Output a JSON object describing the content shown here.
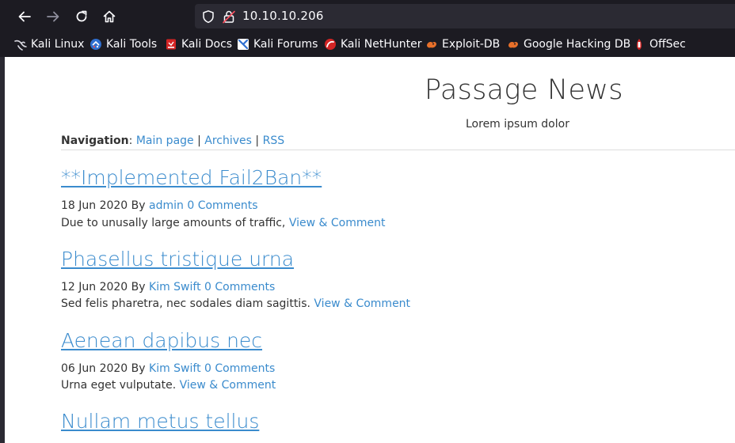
{
  "browser": {
    "url": "10.10.10.206",
    "bookmarks": [
      {
        "label": "Kali Linux",
        "icon": "kali-dragon-icon",
        "color": "#111111"
      },
      {
        "label": "Kali Tools",
        "icon": "kali-tools-icon",
        "color": "#2f6fd0"
      },
      {
        "label": "Kali Docs",
        "icon": "kali-docs-icon",
        "color": "#d42424"
      },
      {
        "label": "Kali Forums",
        "icon": "kali-forums-icon",
        "color": "#2f6fd0"
      },
      {
        "label": "Kali NetHunter",
        "icon": "nethunter-icon",
        "color": "#d42424"
      },
      {
        "label": "Exploit-DB",
        "icon": "exploit-db-icon",
        "color": "#e8702a"
      },
      {
        "label": "Google Hacking DB",
        "icon": "ghdb-icon",
        "color": "#e8702a"
      },
      {
        "label": "OffSec",
        "icon": "offsec-icon",
        "color": "#d42424"
      }
    ]
  },
  "site": {
    "title": "Passage News",
    "subtitle": "Lorem ipsum dolor"
  },
  "nav": {
    "label": "Navigation",
    "separator_colon": ":",
    "links": [
      "Main page",
      "Archives",
      "RSS"
    ],
    "separator": "|"
  },
  "posts": [
    {
      "title": "**Implemented Fail2Ban**",
      "date_by": "18 Jun 2020 By",
      "author": "admin",
      "comments": "0 Comments",
      "excerpt": "Due to unusally large amounts of traffic,",
      "link": "View & Comment"
    },
    {
      "title": "Phasellus tristique urna",
      "date_by": "12 Jun 2020 By",
      "author": "Kim Swift",
      "comments": "0 Comments",
      "excerpt": "Sed felis pharetra, nec sodales diam sagittis.",
      "link": "View & Comment"
    },
    {
      "title": "Aenean dapibus nec",
      "date_by": "06 Jun 2020 By",
      "author": "Kim Swift",
      "comments": "0 Comments",
      "excerpt": "Urna eget vulputate.",
      "link": "View & Comment"
    },
    {
      "title": "Nullam metus tellus"
    }
  ]
}
